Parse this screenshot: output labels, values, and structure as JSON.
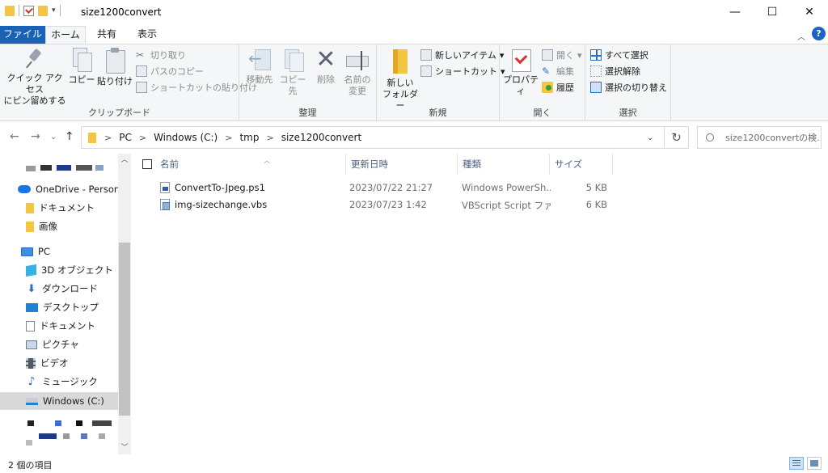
{
  "window": {
    "title": "size1200convert",
    "minimize_glyph": "—",
    "maximize_glyph": "☐",
    "close_glyph": "✕"
  },
  "menu_tabs": {
    "file": "ファイル",
    "home": "ホーム",
    "share": "共有",
    "view": "表示"
  },
  "ribbon": {
    "clipboard": {
      "group_label": "クリップボード",
      "pin_line1": "クイック アクセス",
      "pin_line2": "にピン留めする",
      "copy": "コピー",
      "paste": "貼り付け",
      "cut": "切り取り",
      "copy_path": "パスのコピー",
      "paste_shortcut": "ショートカットの貼り付け"
    },
    "organize": {
      "group_label": "整理",
      "move_to": "移動先",
      "copy_to": "コピー先",
      "delete": "削除",
      "rename_line1": "名前の",
      "rename_line2": "変更"
    },
    "new": {
      "group_label": "新規",
      "new_folder_line1": "新しい",
      "new_folder_line2": "フォルダー",
      "new_item": "新しいアイテム",
      "shortcut": "ショートカット"
    },
    "open": {
      "group_label": "開く",
      "properties": "プロパティ",
      "open": "開く",
      "edit": "編集",
      "history": "履歴"
    },
    "select": {
      "group_label": "選択",
      "select_all": "すべて選択",
      "select_none": "選択解除",
      "invert": "選択の切り替え"
    }
  },
  "address": {
    "crumbs": [
      "PC",
      "Windows (C:)",
      "tmp",
      "size1200convert"
    ],
    "search_placeholder": "size1200convertの検..."
  },
  "nav_pane": {
    "items": [
      {
        "label": "OneDrive - Personal",
        "icon": "cloud-icon"
      },
      {
        "label": "ドキュメント",
        "icon": "folder-icon"
      },
      {
        "label": "画像",
        "icon": "folder-icon"
      },
      {
        "label": "PC",
        "icon": "pc-icon"
      },
      {
        "label": "3D オブジェクト",
        "icon": "cube-icon"
      },
      {
        "label": "ダウンロード",
        "icon": "download-icon"
      },
      {
        "label": "デスクトップ",
        "icon": "desktop-icon"
      },
      {
        "label": "ドキュメント",
        "icon": "document-icon"
      },
      {
        "label": "ピクチャ",
        "icon": "picture-icon"
      },
      {
        "label": "ビデオ",
        "icon": "video-icon"
      },
      {
        "label": "ミュージック",
        "icon": "music-icon"
      },
      {
        "label": "Windows (C:)",
        "icon": "drive-icon",
        "selected": true
      }
    ]
  },
  "file_list": {
    "columns": [
      "名前",
      "更新日時",
      "種類",
      "サイズ"
    ],
    "rows": [
      {
        "name": "ConvertTo-Jpeg.ps1",
        "modified": "2023/07/22 21:27",
        "type": "Windows PowerSh...",
        "size": "5 KB",
        "icon": "powershell-file-icon"
      },
      {
        "name": "img-sizechange.vbs",
        "modified": "2023/07/23 1:42",
        "type": "VBScript Script ファ...",
        "size": "6 KB",
        "icon": "vbscript-file-icon"
      }
    ]
  },
  "status": {
    "item_count": "2 個の項目"
  },
  "colors": {
    "file_tab": "#1a62b5",
    "ribbon_bg": "#f5f6f7",
    "folder": "#f4c542",
    "selection": "#d9d9d9",
    "header_text": "#4d6382"
  }
}
